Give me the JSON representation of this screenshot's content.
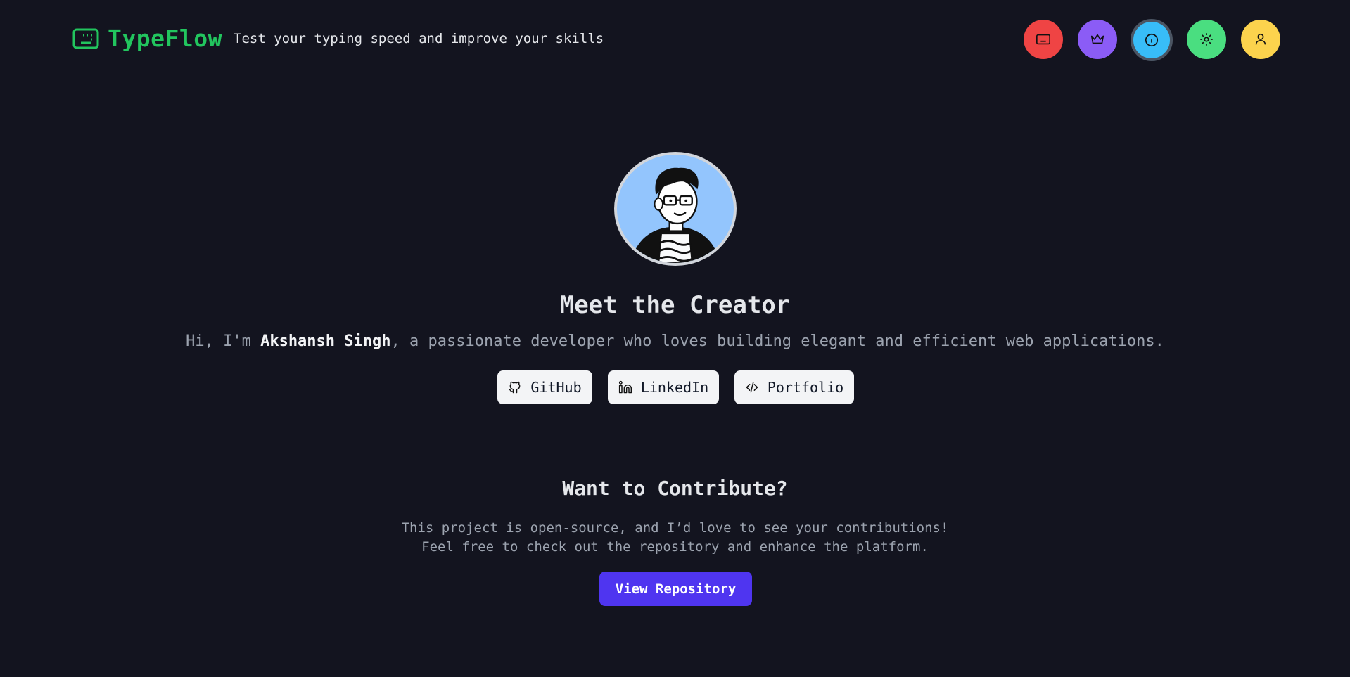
{
  "header": {
    "app_name": "TypeFlow",
    "tagline": "Test your typing speed and improve your skills",
    "brand_color": "#22c55e",
    "nav": [
      {
        "name": "typing-test",
        "icon": "keyboard-icon",
        "color": "#ef4444"
      },
      {
        "name": "leaderboard",
        "icon": "crown-icon",
        "color": "#8b5cf6"
      },
      {
        "name": "about",
        "icon": "info-icon",
        "color": "#38bdf8",
        "active": true
      },
      {
        "name": "settings",
        "icon": "gear-icon",
        "color": "#4ade80"
      },
      {
        "name": "profile",
        "icon": "user-icon",
        "color": "#fcd34d"
      }
    ]
  },
  "hero": {
    "title": "Meet the Creator",
    "intro_prefix": "Hi, I'm ",
    "creator_name": "Akshansh Singh",
    "intro_suffix": ", a passionate developer who loves building elegant and efficient web applications.",
    "links": {
      "github": "GitHub",
      "linkedin": "LinkedIn",
      "portfolio": "Portfolio"
    }
  },
  "contribute": {
    "title": "Want to Contribute?",
    "line1": "This project is open-source, and I’d love to see your contributions!",
    "line2": "Feel free to check out the repository and enhance the platform.",
    "button": "View Repository",
    "button_color": "#4f35f0"
  },
  "colors": {
    "background": "#13141f",
    "text_muted": "#9ca3af"
  }
}
